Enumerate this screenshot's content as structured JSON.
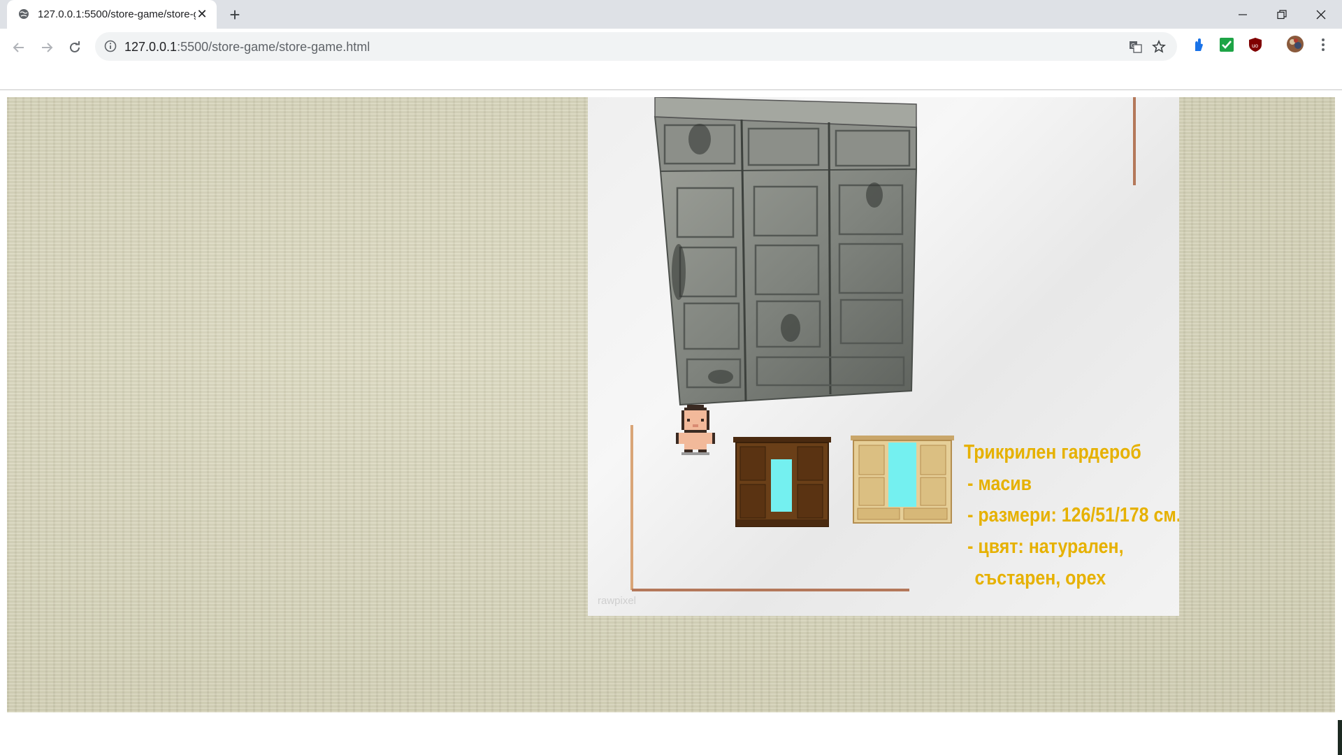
{
  "browser": {
    "tab": {
      "title": "127.0.0.1:5500/store-game/store-game.html"
    },
    "address": {
      "host": "127.0.0.1",
      "path": ":5500/store-game/store-game.html"
    }
  },
  "game": {
    "product": {
      "title": "Трикрилен гардероб",
      "lines": [
        "- масив",
        "- размери: 126/51/178 см.",
        "- цвят: натурален,",
        "състарен, орех"
      ],
      "watermark": "rawpixel"
    }
  }
}
